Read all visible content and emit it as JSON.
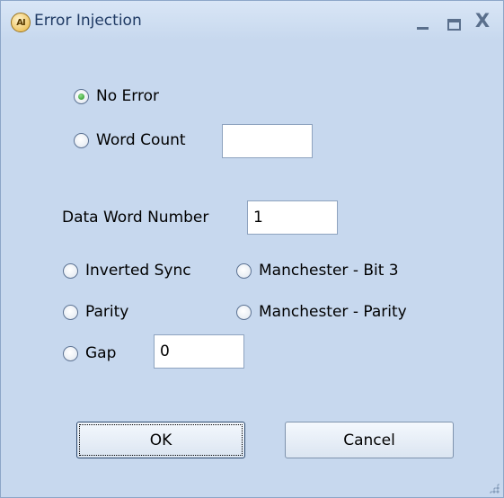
{
  "window": {
    "title": "Error Injection",
    "app_icon_text": "AI",
    "buttons": {
      "minimize": "minimize-icon",
      "maximize": "maximize-icon",
      "close": "X"
    }
  },
  "options": {
    "no_error": {
      "label": "No Error",
      "checked": true
    },
    "word_count": {
      "label": "Word Count",
      "checked": false,
      "value": ""
    },
    "inverted_sync": {
      "label": "Inverted Sync",
      "checked": false
    },
    "manchester_bit3": {
      "label": "Manchester - Bit 3",
      "checked": false
    },
    "parity": {
      "label": "Parity",
      "checked": false
    },
    "manchester_parity": {
      "label": "Manchester - Parity",
      "checked": false
    },
    "gap": {
      "label": "Gap",
      "checked": false,
      "value": "0"
    }
  },
  "data_word": {
    "label": "Data Word Number",
    "value": "1"
  },
  "buttons": {
    "ok": "OK",
    "cancel": "Cancel"
  },
  "colors": {
    "window_bg": "#c7d8ee",
    "title_text": "#1f3a64",
    "radio_checked": "#1f8c1d"
  }
}
